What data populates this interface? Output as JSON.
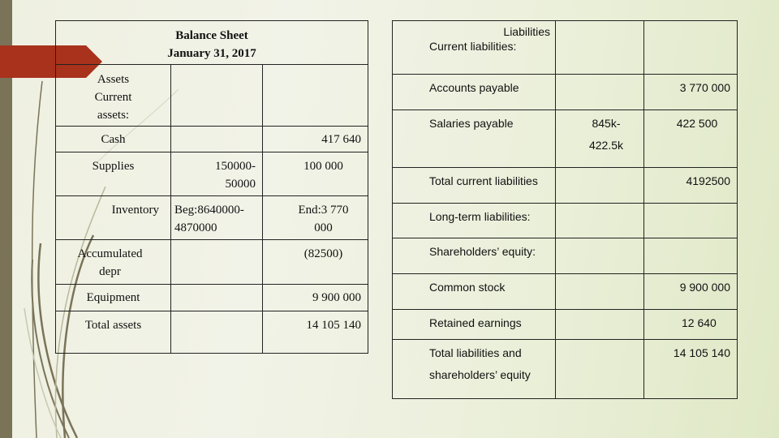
{
  "slide": {
    "accent_color": "#a8321c",
    "sidebar_color": "#7a7358"
  },
  "left_table": {
    "title": "Balance Sheet",
    "date": "January 31, 2017",
    "rows": [
      {
        "label": "Assets\nCurrent\nassets:",
        "calc": "",
        "amount": ""
      },
      {
        "label": "Cash",
        "calc": "",
        "amount": "417 640"
      },
      {
        "label": "Supplies",
        "calc": "150000-\n50000",
        "amount": "100 000"
      },
      {
        "label": "Inventory",
        "calc": "Beg:8640000-\n4870000",
        "amount": "End:3 770\n000"
      },
      {
        "label": "Accumulated\ndepr",
        "calc": "",
        "amount": "(82500)"
      },
      {
        "label": "Equipment",
        "calc": "",
        "amount": "9 900 000"
      },
      {
        "label": "Total assets",
        "calc": "",
        "amount": "14 105 140"
      }
    ]
  },
  "right_table": {
    "header_title": "Liabilities",
    "header_subtitle": "Current liabilities:",
    "rows": [
      {
        "label": "Accounts payable",
        "calc": "",
        "amount": "3 770 000"
      },
      {
        "label": "Salaries payable",
        "calc": "845k-\n422.5k",
        "amount": "422 500"
      },
      {
        "label": "Total  current liabilities",
        "calc": "",
        "amount": "4192500"
      },
      {
        "label": "Long-term liabilities:",
        "calc": "",
        "amount": ""
      },
      {
        "label": "Shareholders’ equity:",
        "calc": "",
        "amount": ""
      },
      {
        "label": "Common stock",
        "calc": "",
        "amount": "9 900 000"
      },
      {
        "label": "Retained earnings",
        "calc": "",
        "amount": "12 640"
      },
      {
        "label": "Total liabilities and\nshareholders’ equity",
        "calc": "",
        "amount": "14 105 140"
      }
    ]
  }
}
